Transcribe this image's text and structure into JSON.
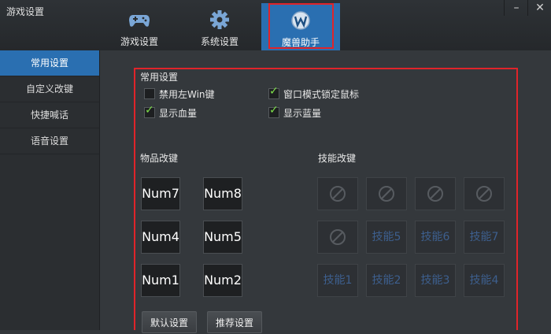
{
  "window": {
    "title": "游戏设置",
    "minimize_glyph": "–",
    "close_glyph": "✕"
  },
  "tabs": [
    {
      "label": "游戏设置",
      "icon": "gamepad-icon",
      "active": false
    },
    {
      "label": "系统设置",
      "icon": "gear-icon",
      "active": false
    },
    {
      "label": "魔兽助手",
      "icon": "warcraft-logo-icon",
      "active": true
    }
  ],
  "sidebar": {
    "items": [
      {
        "label": "常用设置",
        "active": true
      },
      {
        "label": "自定义改键",
        "active": false
      },
      {
        "label": "快捷喊话",
        "active": false
      },
      {
        "label": "语音设置",
        "active": false
      }
    ]
  },
  "common": {
    "title": "常用设置",
    "options": [
      {
        "label": "禁用左Win键",
        "checked": false
      },
      {
        "label": "窗口模式锁定鼠标",
        "checked": true
      },
      {
        "label": "显示血量",
        "checked": true
      },
      {
        "label": "显示蓝量",
        "checked": true
      }
    ]
  },
  "items": {
    "title": "物品改键",
    "keys": [
      "Num7",
      "Num8",
      "Num4",
      "Num5",
      "Num1",
      "Num2"
    ]
  },
  "skills": {
    "title": "技能改键",
    "row1": [
      "",
      "",
      "",
      ""
    ],
    "row2": [
      "",
      "技能5",
      "技能6",
      "技能7"
    ],
    "row3": [
      "技能1",
      "技能2",
      "技能3",
      "技能4"
    ]
  },
  "buttons": {
    "default": "默认设置",
    "recommended": "推荐设置"
  },
  "colors": {
    "accent": "#2a6fb1",
    "highlight": "#e0242a",
    "check": "#7ee04a"
  }
}
